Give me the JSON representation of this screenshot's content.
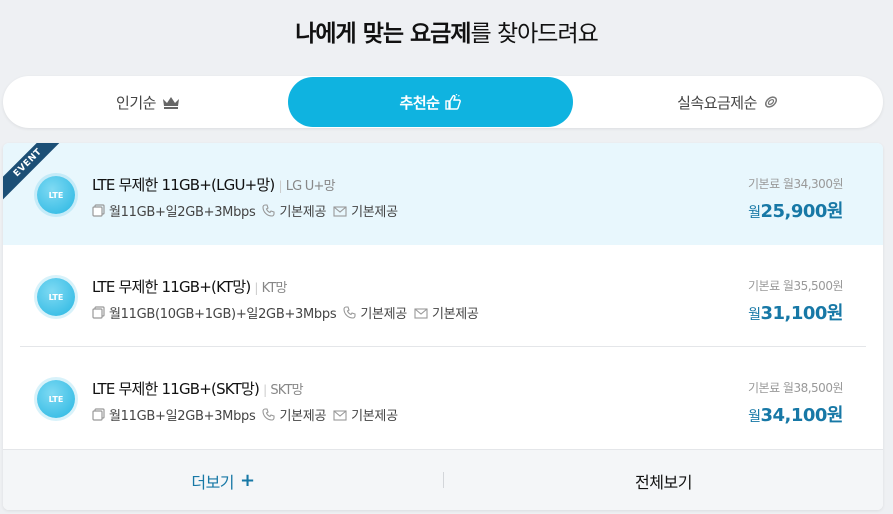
{
  "heading": {
    "bold": "나에게 맞는 요금제",
    "rest": "를 찾아드려요"
  },
  "tabs": [
    {
      "label": "인기순",
      "icon": "crown-icon",
      "active": false
    },
    {
      "label": "추천순",
      "icon": "thumbs-up-icon",
      "active": true
    },
    {
      "label": "실속요금제순",
      "icon": "coin-icon",
      "active": false
    }
  ],
  "accent_color": "#0fb3e0",
  "price_color": "#1778a6",
  "plans": [
    {
      "event": "EVENT",
      "badge": "LTE",
      "name": "LTE 무제한 11GB+(LGU+망)",
      "carrier": "LG U+망",
      "data": "월11GB+일2GB+3Mbps",
      "voice": "기본제공",
      "sms": "기본제공",
      "original_price": "기본료 월34,300원",
      "price_prefix": "월",
      "price": "25,900원"
    },
    {
      "badge": "LTE",
      "name": "LTE 무제한 11GB+(KT망)",
      "carrier": "KT망",
      "data": "월11GB(10GB+1GB)+일2GB+3Mbps",
      "voice": "기본제공",
      "sms": "기본제공",
      "original_price": "기본료 월35,500원",
      "price_prefix": "월",
      "price": "31,100원"
    },
    {
      "badge": "LTE",
      "name": "LTE 무제한 11GB+(SKT망)",
      "carrier": "SKT망",
      "data": "월11GB+일2GB+3Mbps",
      "voice": "기본제공",
      "sms": "기본제공",
      "original_price": "기본료 월38,500원",
      "price_prefix": "월",
      "price": "34,100원"
    }
  ],
  "footer": {
    "more": "더보기",
    "more_icon": "plus-icon",
    "all": "전체보기"
  }
}
